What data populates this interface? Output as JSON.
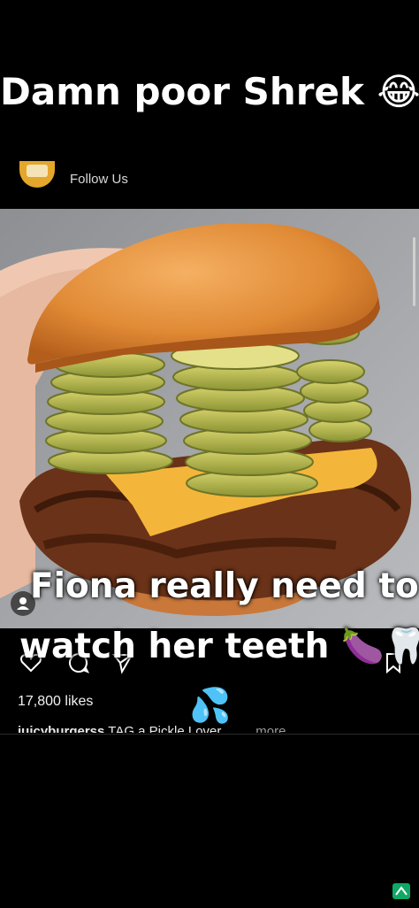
{
  "meme": {
    "top_caption": "Damn poor Shrek",
    "top_caption_emoji": "😂",
    "overlay_caption_line1": "Fiona really need to",
    "overlay_caption_line2": "watch her teeth",
    "overlay_caption_emojis": "🍆🦷",
    "droplets_emoji": "💦"
  },
  "post": {
    "follow_label": "Follow Us",
    "likes": "17,800 likes",
    "caption_user": "juicyburgerss",
    "caption_text": "TAG a Pickle Lover",
    "caption_more": "... more"
  },
  "icons": {
    "heart": "heart-icon",
    "comment": "comment-icon",
    "share": "send-icon",
    "bookmark": "bookmark-icon",
    "tag_person": "person-icon",
    "corner": "app-badge-icon"
  },
  "colors": {
    "background": "#000000",
    "bun": "#d9822e",
    "pickle": "#b7b84a",
    "cheese": "#f4b63a",
    "patty": "#6a3218"
  }
}
